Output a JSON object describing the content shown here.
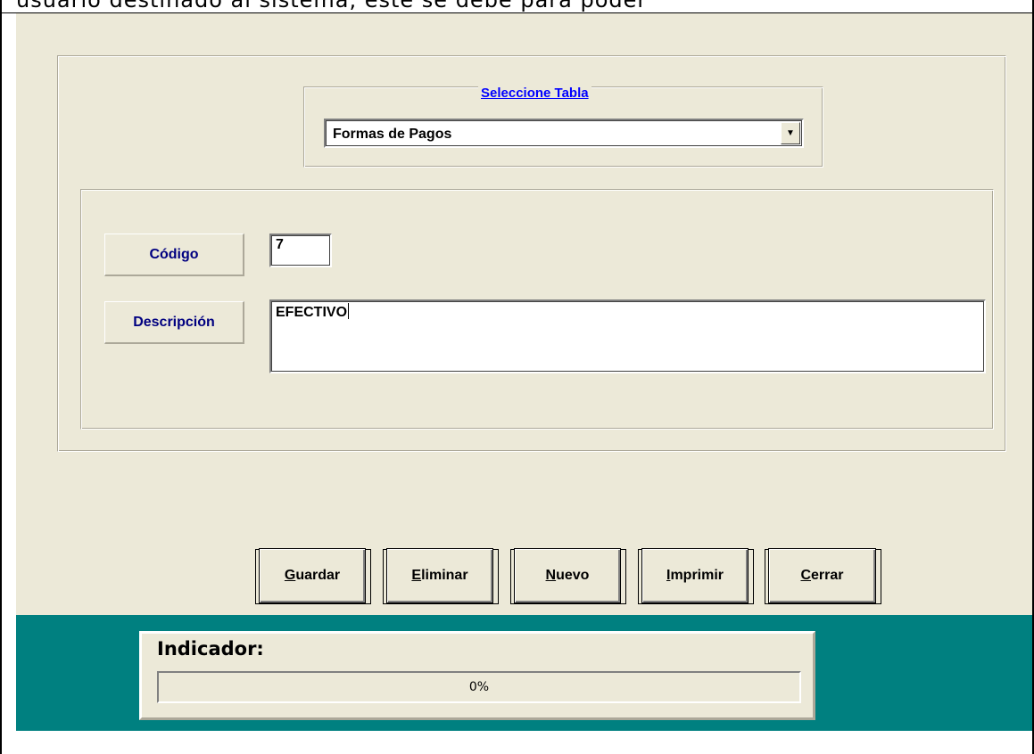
{
  "document": {
    "text_line": "usuario destinado al sistema, este se debe para poder"
  },
  "form": {
    "table_selector": {
      "label": "Seleccione Tabla",
      "selected": "Formas de Pagos"
    },
    "codigo": {
      "label": "Código",
      "value": "7"
    },
    "descripcion": {
      "label": "Descripción",
      "value": "EFECTIVO"
    },
    "buttons": {
      "guardar": {
        "mnemonic": "G",
        "rest": "uardar"
      },
      "eliminar": {
        "mnemonic": "E",
        "rest": "liminar"
      },
      "nuevo": {
        "mnemonic": "N",
        "rest": "uevo"
      },
      "imprimir": {
        "mnemonic": "I",
        "rest": "mprimir"
      },
      "cerrar": {
        "mnemonic": "C",
        "rest": "errar"
      }
    }
  },
  "indicator": {
    "label": "Indicador:",
    "progress_text": "0%",
    "progress_fraction": 0
  },
  "colors": {
    "form_bg": "#ece9d8",
    "status_bg": "#008080",
    "label_text": "#000080",
    "link_text": "#0000ff"
  }
}
